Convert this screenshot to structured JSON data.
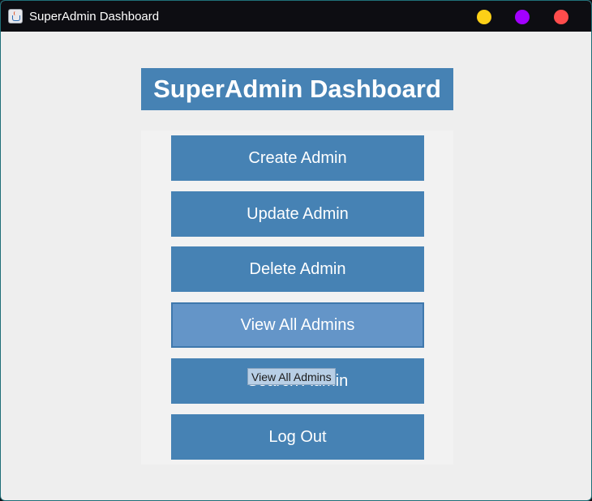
{
  "window": {
    "title": "SuperAdmin Dashboard",
    "controls": {
      "minimize_color": "#fdd017",
      "maximize_color": "#a200ff",
      "close_color": "#ff4c4c"
    }
  },
  "header": {
    "title": "SuperAdmin Dashboard"
  },
  "menu": {
    "items": [
      {
        "label": "Create Admin"
      },
      {
        "label": "Update Admin"
      },
      {
        "label": "Delete Admin"
      },
      {
        "label": "View All Admins"
      },
      {
        "label": "Search Admin"
      },
      {
        "label": "Log Out"
      }
    ],
    "hovered_index": 3
  },
  "tooltip": {
    "text": "View All Admins"
  },
  "colors": {
    "accent": "#4682b4",
    "accent_hover": "#6495c8",
    "background": "#eeeeee",
    "titlebar": "#0d0d12"
  }
}
